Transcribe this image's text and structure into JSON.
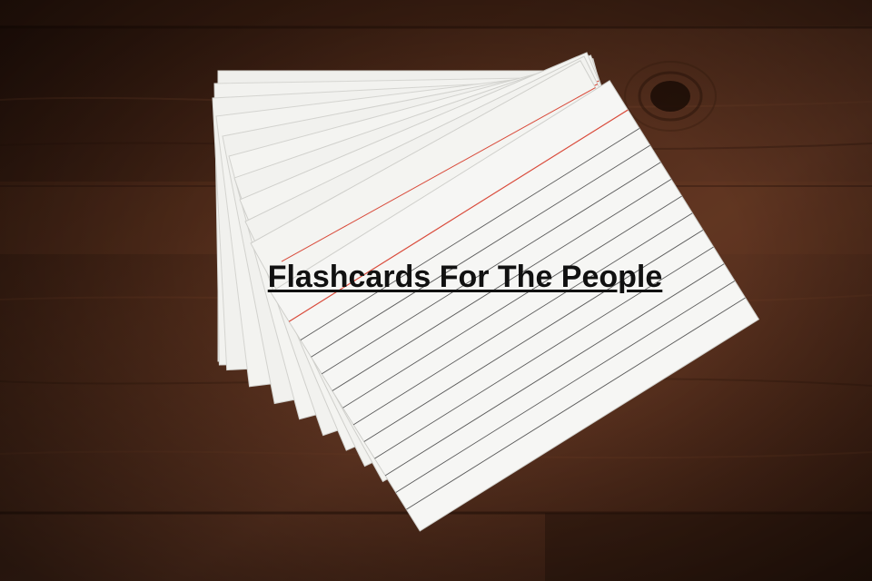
{
  "header": {
    "title": "Flashcards For The People"
  },
  "theme": {
    "title_color": "#111111",
    "wood_color": "#5a3320",
    "card_color": "#f4f4f2",
    "ruling_color": "#555555",
    "margin_line_color": "#d94a3a"
  },
  "media": {
    "background_icon": "fanned-index-cards-on-wood-table"
  }
}
